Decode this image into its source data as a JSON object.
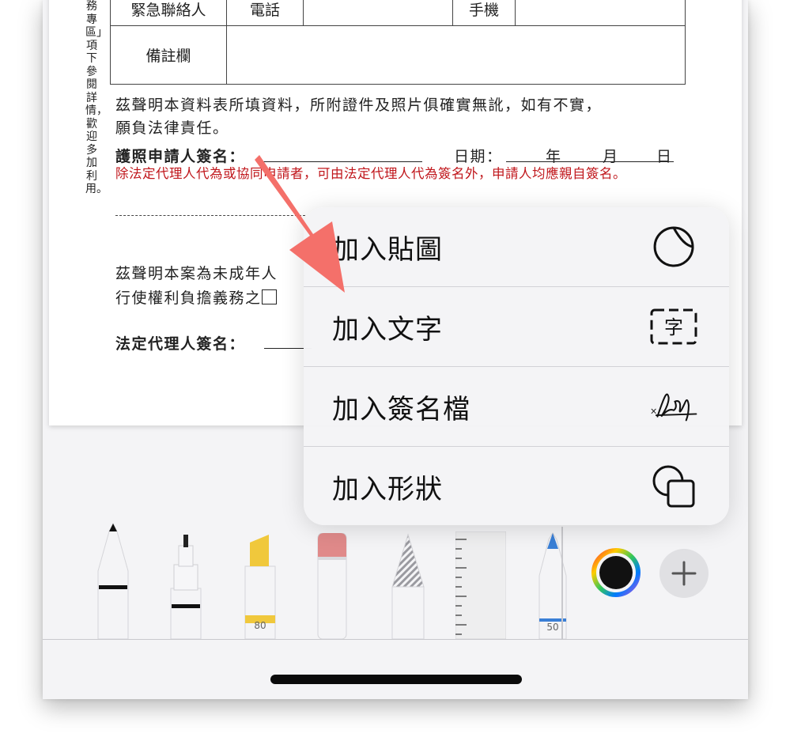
{
  "document": {
    "side_note": "務專區」項下參閱詳情，歡迎多加利用。",
    "table": {
      "emergency_contact_label": "緊急聯絡人",
      "phone_label": "電話",
      "mobile_label": "手機",
      "remarks_label": "備註欄"
    },
    "declaration_line1": "茲聲明本資料表所填資料，所附證件及照片俱確實無訛，如有不實，",
    "declaration_line2": "願負法律責任。",
    "signature_label": "護照申請人簽名：",
    "date_label": "日期：",
    "date_year": "年",
    "date_month": "月",
    "date_day": "日",
    "red_note": "除法定代理人代為或協同申請者，可由法定代理人代為簽名外，申請人均應親自簽名。",
    "minor_line1": "茲聲明本案為未成年人",
    "minor_line2": "行使權利負擔義務之",
    "guardian_signature_label": "法定代理人簽名："
  },
  "menu": {
    "items": [
      {
        "label": "加入貼圖",
        "icon": "sticker-icon"
      },
      {
        "label": "加入文字",
        "icon": "text-box-icon",
        "icon_text": "字"
      },
      {
        "label": "加入簽名檔",
        "icon": "signature-icon"
      },
      {
        "label": "加入形狀",
        "icon": "shapes-icon"
      }
    ]
  },
  "tools": {
    "marker_opacity": "80",
    "crayon_size": "50",
    "colors": {
      "highlighter": "#f0c83c",
      "eraser": "#e08a8a",
      "crayon": "#3a7fd6",
      "pen": "#111111"
    }
  },
  "colors": {
    "accent_arrow": "#f4706a",
    "red_text": "#c0161b",
    "menu_bg": "#f4f4f6"
  }
}
